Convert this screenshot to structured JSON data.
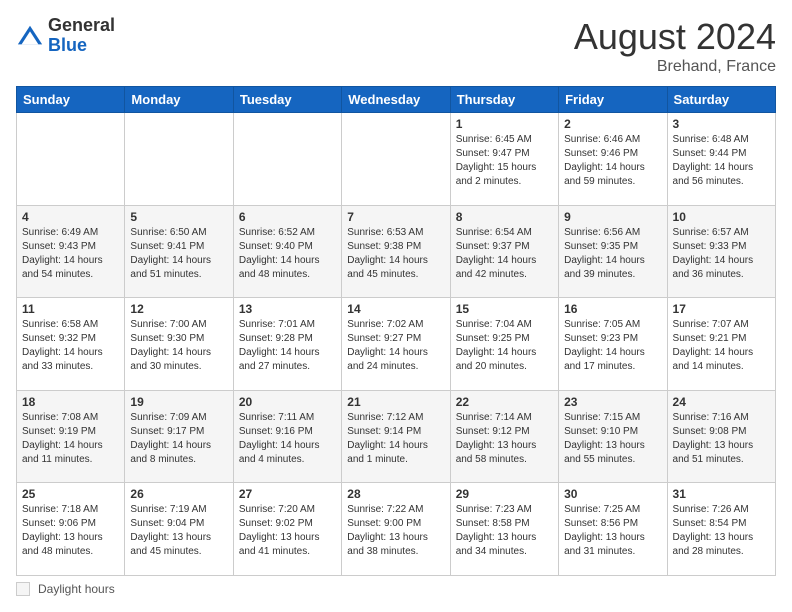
{
  "header": {
    "logo_general": "General",
    "logo_blue": "Blue",
    "month_title": "August 2024",
    "location": "Brehand, France"
  },
  "footer": {
    "daylight_label": "Daylight hours"
  },
  "weekdays": [
    "Sunday",
    "Monday",
    "Tuesday",
    "Wednesday",
    "Thursday",
    "Friday",
    "Saturday"
  ],
  "weeks": [
    [
      {
        "day": "",
        "info": ""
      },
      {
        "day": "",
        "info": ""
      },
      {
        "day": "",
        "info": ""
      },
      {
        "day": "",
        "info": ""
      },
      {
        "day": "1",
        "info": "Sunrise: 6:45 AM\nSunset: 9:47 PM\nDaylight: 15 hours\nand 2 minutes."
      },
      {
        "day": "2",
        "info": "Sunrise: 6:46 AM\nSunset: 9:46 PM\nDaylight: 14 hours\nand 59 minutes."
      },
      {
        "day": "3",
        "info": "Sunrise: 6:48 AM\nSunset: 9:44 PM\nDaylight: 14 hours\nand 56 minutes."
      }
    ],
    [
      {
        "day": "4",
        "info": "Sunrise: 6:49 AM\nSunset: 9:43 PM\nDaylight: 14 hours\nand 54 minutes."
      },
      {
        "day": "5",
        "info": "Sunrise: 6:50 AM\nSunset: 9:41 PM\nDaylight: 14 hours\nand 51 minutes."
      },
      {
        "day": "6",
        "info": "Sunrise: 6:52 AM\nSunset: 9:40 PM\nDaylight: 14 hours\nand 48 minutes."
      },
      {
        "day": "7",
        "info": "Sunrise: 6:53 AM\nSunset: 9:38 PM\nDaylight: 14 hours\nand 45 minutes."
      },
      {
        "day": "8",
        "info": "Sunrise: 6:54 AM\nSunset: 9:37 PM\nDaylight: 14 hours\nand 42 minutes."
      },
      {
        "day": "9",
        "info": "Sunrise: 6:56 AM\nSunset: 9:35 PM\nDaylight: 14 hours\nand 39 minutes."
      },
      {
        "day": "10",
        "info": "Sunrise: 6:57 AM\nSunset: 9:33 PM\nDaylight: 14 hours\nand 36 minutes."
      }
    ],
    [
      {
        "day": "11",
        "info": "Sunrise: 6:58 AM\nSunset: 9:32 PM\nDaylight: 14 hours\nand 33 minutes."
      },
      {
        "day": "12",
        "info": "Sunrise: 7:00 AM\nSunset: 9:30 PM\nDaylight: 14 hours\nand 30 minutes."
      },
      {
        "day": "13",
        "info": "Sunrise: 7:01 AM\nSunset: 9:28 PM\nDaylight: 14 hours\nand 27 minutes."
      },
      {
        "day": "14",
        "info": "Sunrise: 7:02 AM\nSunset: 9:27 PM\nDaylight: 14 hours\nand 24 minutes."
      },
      {
        "day": "15",
        "info": "Sunrise: 7:04 AM\nSunset: 9:25 PM\nDaylight: 14 hours\nand 20 minutes."
      },
      {
        "day": "16",
        "info": "Sunrise: 7:05 AM\nSunset: 9:23 PM\nDaylight: 14 hours\nand 17 minutes."
      },
      {
        "day": "17",
        "info": "Sunrise: 7:07 AM\nSunset: 9:21 PM\nDaylight: 14 hours\nand 14 minutes."
      }
    ],
    [
      {
        "day": "18",
        "info": "Sunrise: 7:08 AM\nSunset: 9:19 PM\nDaylight: 14 hours\nand 11 minutes."
      },
      {
        "day": "19",
        "info": "Sunrise: 7:09 AM\nSunset: 9:17 PM\nDaylight: 14 hours\nand 8 minutes."
      },
      {
        "day": "20",
        "info": "Sunrise: 7:11 AM\nSunset: 9:16 PM\nDaylight: 14 hours\nand 4 minutes."
      },
      {
        "day": "21",
        "info": "Sunrise: 7:12 AM\nSunset: 9:14 PM\nDaylight: 14 hours\nand 1 minute."
      },
      {
        "day": "22",
        "info": "Sunrise: 7:14 AM\nSunset: 9:12 PM\nDaylight: 13 hours\nand 58 minutes."
      },
      {
        "day": "23",
        "info": "Sunrise: 7:15 AM\nSunset: 9:10 PM\nDaylight: 13 hours\nand 55 minutes."
      },
      {
        "day": "24",
        "info": "Sunrise: 7:16 AM\nSunset: 9:08 PM\nDaylight: 13 hours\nand 51 minutes."
      }
    ],
    [
      {
        "day": "25",
        "info": "Sunrise: 7:18 AM\nSunset: 9:06 PM\nDaylight: 13 hours\nand 48 minutes."
      },
      {
        "day": "26",
        "info": "Sunrise: 7:19 AM\nSunset: 9:04 PM\nDaylight: 13 hours\nand 45 minutes."
      },
      {
        "day": "27",
        "info": "Sunrise: 7:20 AM\nSunset: 9:02 PM\nDaylight: 13 hours\nand 41 minutes."
      },
      {
        "day": "28",
        "info": "Sunrise: 7:22 AM\nSunset: 9:00 PM\nDaylight: 13 hours\nand 38 minutes."
      },
      {
        "day": "29",
        "info": "Sunrise: 7:23 AM\nSunset: 8:58 PM\nDaylight: 13 hours\nand 34 minutes."
      },
      {
        "day": "30",
        "info": "Sunrise: 7:25 AM\nSunset: 8:56 PM\nDaylight: 13 hours\nand 31 minutes."
      },
      {
        "day": "31",
        "info": "Sunrise: 7:26 AM\nSunset: 8:54 PM\nDaylight: 13 hours\nand 28 minutes."
      }
    ]
  ]
}
